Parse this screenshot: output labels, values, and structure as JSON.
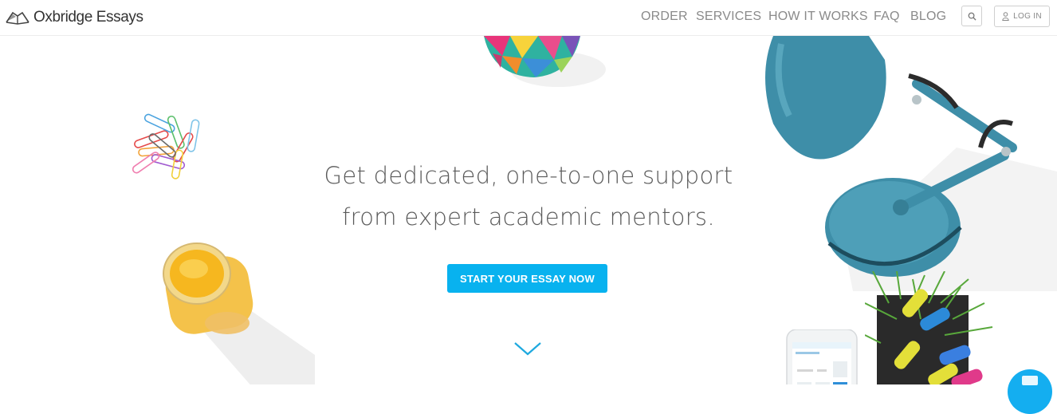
{
  "brand": {
    "name": "Oxbridge Essays"
  },
  "nav": {
    "items": [
      {
        "label": "ORDER"
      },
      {
        "label": "SERVICES"
      },
      {
        "label": "HOW IT WORKS"
      },
      {
        "label": "FAQ"
      },
      {
        "label": "BLOG"
      }
    ],
    "login_label": "LOG IN"
  },
  "hero": {
    "headline_line1": "Get dedicated, one-to-one support",
    "headline_line2": "from expert academic mentors.",
    "cta_label": "START YOUR ESSAY NOW"
  },
  "colors": {
    "accent": "#08b2ef",
    "nav_text": "#8a8a8a",
    "headline_text": "#5a5a5a",
    "lamp": "#3e8ea8"
  },
  "icons": {
    "logo": "book-icon",
    "search": "search-icon",
    "login": "user-icon",
    "scroll": "chevron-down-icon",
    "chat": "chat-icon"
  }
}
